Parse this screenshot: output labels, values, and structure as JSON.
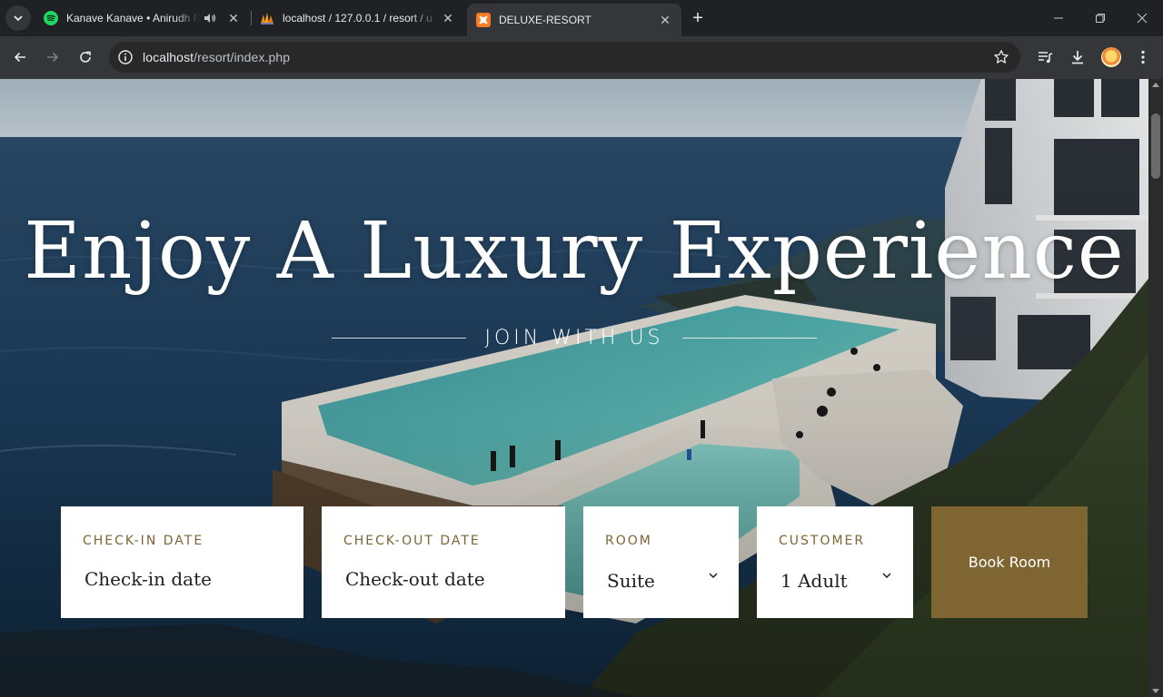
{
  "browser": {
    "tabs": [
      {
        "title": "Kanave Kanave • Anirudh Ra",
        "icon": "spotify-icon",
        "audio": true
      },
      {
        "title": "localhost / 127.0.0.1 / resort / u",
        "icon": "phpmyadmin-icon"
      },
      {
        "title": "DELUXE-RESORT",
        "icon": "xampp-icon",
        "active": true
      }
    ],
    "url": {
      "host": "localhost",
      "path": "/resort/index.php"
    }
  },
  "hero": {
    "headline": "Enjoy A Luxury Experience",
    "subheadline": "JOIN WITH US"
  },
  "booking": {
    "checkin": {
      "label": "CHECK-IN DATE",
      "placeholder": "Check-in date"
    },
    "checkout": {
      "label": "CHECK-OUT DATE",
      "placeholder": "Check-out date"
    },
    "room": {
      "label": "ROOM",
      "selected": "Suite"
    },
    "customer": {
      "label": "CUSTOMER",
      "selected": "1 Adult"
    },
    "submit_label": "Book Room"
  },
  "colors": {
    "accent": "#7f6531",
    "label": "#7d6535",
    "chrome_dark": "#202124",
    "chrome_toolbar": "#35363a"
  }
}
